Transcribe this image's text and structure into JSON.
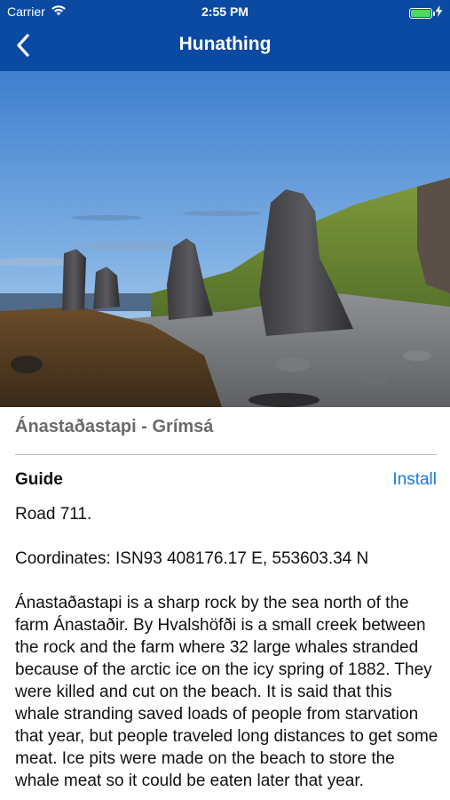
{
  "status_bar": {
    "carrier": "Carrier",
    "time": "2:55 PM",
    "battery_level": 0.9,
    "icons": [
      "wifi-icon",
      "battery-icon",
      "charging-bolt-icon"
    ]
  },
  "nav": {
    "title": "Hunathing",
    "back_icon": "chevron-left-icon",
    "color": "#0b4aa2"
  },
  "place": {
    "title": "Ánastaðastapi - Grímsá"
  },
  "guide": {
    "label": "Guide",
    "install_label": "Install",
    "accent_color": "#1a7ae0"
  },
  "content": {
    "road": "Road 711.",
    "coordinates": "Coordinates: ISN93 408176.17 E, 553603.34 N",
    "description": "Ánastaðastapi is a sharp rock by the sea north of the farm Ánastaðir. By Hvalshöfði is a small creek between the rock and the farm where 32 large whales stranded because of the arctic ice on the icy spring of 1882. They were killed and cut on the beach. It is said that this whale stranding saved loads of people from starvation that year, but people traveled long distances to get some meat. Ice pits were made on the beach to store the whale meat so it could be eaten later that year."
  }
}
